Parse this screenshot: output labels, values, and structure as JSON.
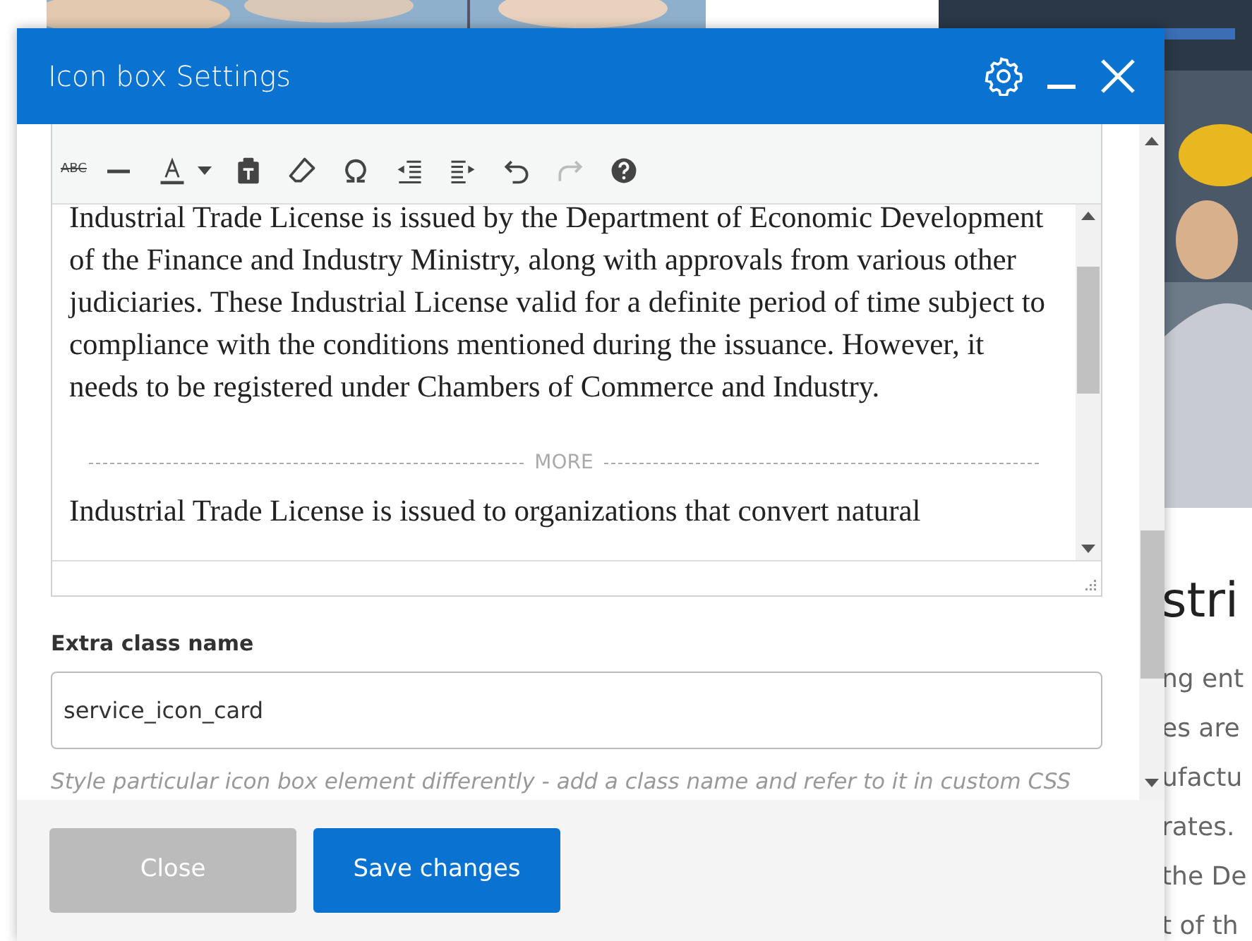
{
  "page": {
    "heading_fragment": "stri",
    "text_fragments": [
      "ng ent",
      "es are",
      "ufactu",
      "rates.",
      "the De",
      "t of th"
    ]
  },
  "dialog": {
    "title": "Icon box Settings",
    "editor": {
      "toolbar": [
        {
          "kind": "strikethrough",
          "label": "ABC",
          "disabled": false
        },
        {
          "kind": "hr",
          "disabled": false
        },
        {
          "kind": "textcolor",
          "disabled": false
        },
        {
          "kind": "dropdown",
          "disabled": false
        },
        {
          "kind": "paste",
          "disabled": false
        },
        {
          "kind": "eraser",
          "disabled": false
        },
        {
          "kind": "omega",
          "disabled": false
        },
        {
          "kind": "outdent",
          "disabled": false
        },
        {
          "kind": "indent",
          "disabled": false
        },
        {
          "kind": "undo",
          "disabled": false
        },
        {
          "kind": "redo",
          "disabled": true
        },
        {
          "kind": "help",
          "disabled": false
        }
      ],
      "paragraphs": [
        "Industrial Trade License is issued by the Department of Economic Development of the Finance and Industry Ministry, along with approvals from various other judiciaries. These Industrial License valid for a definite period of time subject to compliance with the conditions mentioned during the issuance. However, it needs to be registered under Chambers of Commerce and Industry."
      ],
      "more_label": "MORE",
      "after_more": "Industrial Trade License is issued to organizations that convert natural"
    },
    "field": {
      "label": "Extra class name",
      "value": "service_icon_card",
      "help": "Style particular icon box element differently - add a class name and refer to it in custom CSS"
    },
    "buttons": [
      {
        "label": "Close",
        "kind": "secondary"
      },
      {
        "label": "Save changes",
        "kind": "primary"
      }
    ]
  }
}
